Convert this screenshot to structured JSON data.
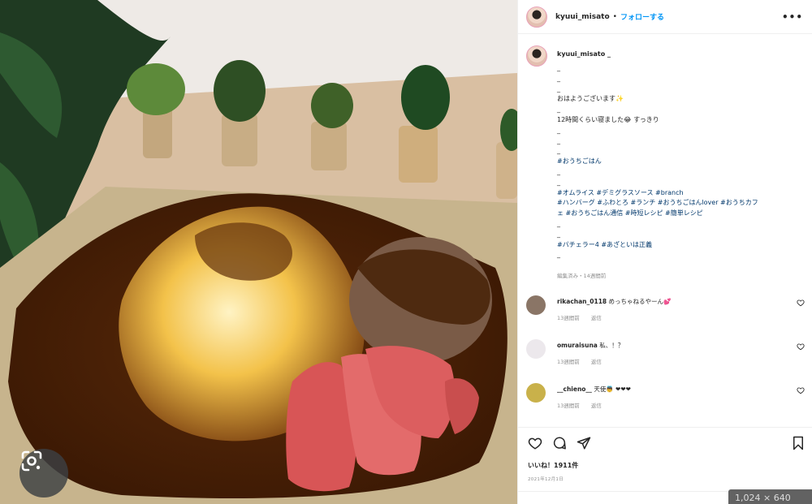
{
  "post": {
    "username": "kyuui_misato",
    "separator": "•",
    "follow_label": "フォローする",
    "more_label": "•••"
  },
  "caption": {
    "username": "kyuui_misato _",
    "lines": [
      "_",
      "_",
      "_",
      "おはようございます✨",
      "_",
      "12時間くらい寝ました😂 すっきり",
      "_",
      "_",
      "_",
      "#おうちごはん",
      "_",
      "_",
      "#オムライス #デミグラスソース #branch",
      "#ハンバーグ #ふわとろ #ランチ #おうちごはんlover #おうちカフ",
      "ェ #おうちごはん通信 #時短レシピ #簡単レシピ",
      "_",
      "_",
      "#バチェラー4 #あざといは正義",
      "_"
    ],
    "meta": "編集済み・14週間前"
  },
  "comments": [
    {
      "user": "rikachan_0118",
      "text": "めっちゃねるやーん💕",
      "time": "13週間前",
      "reply": "返信",
      "avatar_color": "#8a7566"
    },
    {
      "user": "omuraisuna",
      "text": "私、！？",
      "time": "13週間前",
      "reply": "返信",
      "avatar_color": "#ece8ec"
    },
    {
      "user": "__chieno__",
      "text": "天使👼 ❤❤❤",
      "time": "13週間前",
      "reply": "返信",
      "avatar_color": "#c9b14a"
    }
  ],
  "actions": {
    "likes": "いいね！1911件",
    "date": "2021年12月1日"
  },
  "overlay": {
    "dimensions": "1,024 × 640"
  },
  "icons": {
    "lens": "google-lens-icon",
    "heart": "heart-icon",
    "comment": "comment-icon",
    "share": "share-icon",
    "bookmark": "bookmark-icon"
  }
}
